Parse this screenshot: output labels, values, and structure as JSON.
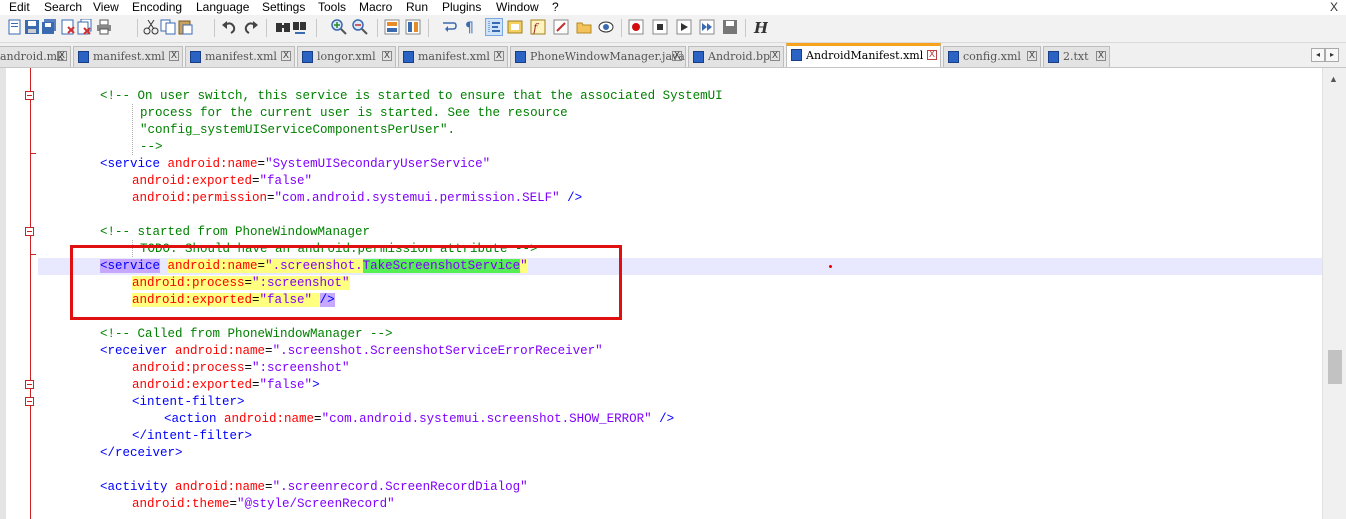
{
  "menu": [
    "Edit",
    "Search",
    "View",
    "Encoding",
    "Language",
    "Settings",
    "Tools",
    "Macro",
    "Run",
    "Plugins",
    "Window",
    "?"
  ],
  "menu_close": "X",
  "toolbar_icons": [
    "open-file-icon",
    "save-icon",
    "save-all-icon",
    "close-file-icon",
    "close-all-icon",
    "print-icon",
    "cut-icon",
    "copy-icon",
    "paste-icon",
    "undo-icon",
    "redo-icon",
    "find-icon",
    "replace-icon",
    "zoom-in-icon",
    "zoom-out-icon",
    "sync-v-icon",
    "sync-h-icon",
    "word-wrap-icon",
    "show-all-chars-icon",
    "indent-guide-icon",
    "doc-map-icon",
    "function-list-icon",
    "folder-workspace-icon",
    "monitor-icon",
    "record-macro-icon",
    "stop-macro-icon",
    "play-macro-icon",
    "run-macro-multiple-icon",
    "save-macro-icon",
    "hex-editor-icon"
  ],
  "tabs": [
    {
      "label": "android.mk",
      "active": false
    },
    {
      "label": "manifest.xml",
      "active": false
    },
    {
      "label": "manifest.xml",
      "active": false
    },
    {
      "label": "longor.xml",
      "active": false
    },
    {
      "label": "manifest.xml",
      "active": false
    },
    {
      "label": "PhoneWindowManager.java",
      "active": false
    },
    {
      "label": "Android.bp",
      "active": false
    },
    {
      "label": "AndroidManifest.xml",
      "active": true
    },
    {
      "label": "config.xml",
      "active": false
    },
    {
      "label": "2.txt",
      "active": false
    }
  ],
  "tab_close": "X",
  "tab_nav": [
    "◂",
    "▸"
  ],
  "editor": {
    "l1a": "<!-- On user switch, this service is started to ensure that the associated SystemUI",
    "l1b": "process for the current user is started. See the resource",
    "l1c": "\"config_systemUIServiceComponentsPerUser\".",
    "l1d": "-->",
    "l2_tag": "<service",
    "l2_attr": "android:name",
    "l2_eq": "=",
    "l2_val": "\"SystemUISecondaryUserService\"",
    "l3_attr": "android:exported",
    "l3_eq": "=",
    "l3_val": "\"false\"",
    "l4_attr": "android:permission",
    "l4_eq": "=",
    "l4_val": "\"com.android.systemui.permission.SELF\"",
    "l4_end": " />",
    "l5a": "<!-- started from PhoneWindowManager",
    "l5b": "TODO: Should have an android:permission attribute -->",
    "l6_tag": "<service",
    "l6_attr": "android:name",
    "l6_eq": "=",
    "l6_val1": "\".screenshot.",
    "l6_val2": "TakeScreenshotService",
    "l6_val3": "\"",
    "l7_attr": "android:process",
    "l7_eq": "=",
    "l7_val": "\":screenshot\"",
    "l8_attr": "android:exported",
    "l8_eq": "=",
    "l8_val": "\"false\"",
    "l8_sp": " ",
    "l8_end": "/>",
    "l9": "<!-- Called from PhoneWindowManager -->",
    "l10_tag": "<receiver",
    "l10_attr": "android:name",
    "l10_eq": "=",
    "l10_val": "\".screenshot.ScreenshotServiceErrorReceiver\"",
    "l11_attr": "android:process",
    "l11_eq": "=",
    "l11_val": "\":screenshot\"",
    "l12_attr": "android:exported",
    "l12_eq": "=",
    "l12_val": "\"false\"",
    "l12_end": ">",
    "l13": "<intent-filter>",
    "l14_tag": "<action",
    "l14_attr": "android:name",
    "l14_eq": "=",
    "l14_val": "\"com.android.systemui.screenshot.SHOW_ERROR\"",
    "l14_end": " />",
    "l15": "</intent-filter>",
    "l16": "</receiver>",
    "l17_tag": "<activity",
    "l17_attr": "android:name",
    "l17_eq": "=",
    "l17_val": "\".screenrecord.ScreenRecordDialog\"",
    "l18_attr": "android:theme",
    "l18_eq": "=",
    "l18_val": "\"@style/ScreenRecord\""
  }
}
